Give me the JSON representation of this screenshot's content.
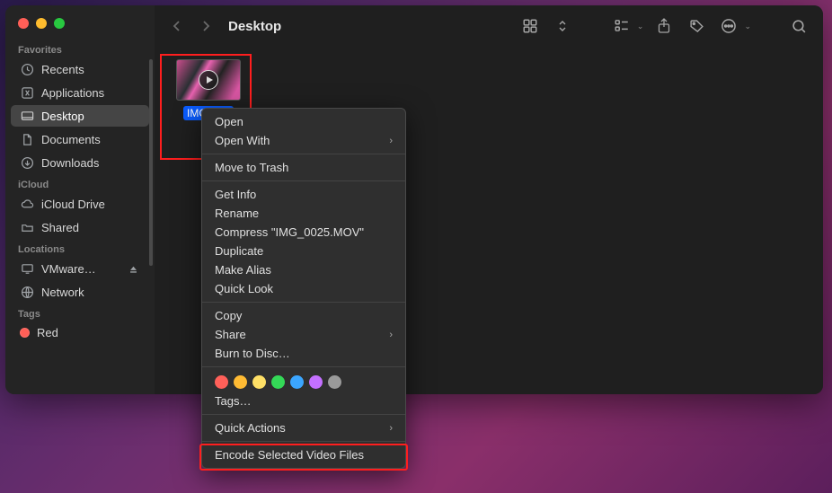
{
  "window": {
    "title": "Desktop"
  },
  "sidebar": {
    "sections": {
      "favorites": {
        "label": "Favorites",
        "items": [
          {
            "label": "Recents"
          },
          {
            "label": "Applications"
          },
          {
            "label": "Desktop"
          },
          {
            "label": "Documents"
          },
          {
            "label": "Downloads"
          }
        ]
      },
      "icloud": {
        "label": "iCloud",
        "items": [
          {
            "label": "iCloud Drive"
          },
          {
            "label": "Shared"
          }
        ]
      },
      "locations": {
        "label": "Locations",
        "items": [
          {
            "label": "VMware…"
          },
          {
            "label": "Network"
          }
        ]
      },
      "tags": {
        "label": "Tags",
        "items": [
          {
            "label": "Red",
            "color": "#ff5f57"
          }
        ]
      }
    }
  },
  "file": {
    "name": "IMG_0025.MOV",
    "displayed_name": "IMG_0…"
  },
  "context_menu": {
    "open": "Open",
    "open_with": "Open With",
    "move_to_trash": "Move to Trash",
    "get_info": "Get Info",
    "rename": "Rename",
    "compress": "Compress \"IMG_0025.MOV\"",
    "duplicate": "Duplicate",
    "make_alias": "Make Alias",
    "quick_look": "Quick Look",
    "copy": "Copy",
    "share": "Share",
    "burn": "Burn to Disc…",
    "tags_label": "Tags…",
    "quick_actions": "Quick Actions",
    "encode": "Encode Selected Video Files",
    "tag_colors": [
      "#ff6059",
      "#ffbb33",
      "#ffe066",
      "#34d957",
      "#3ba6ff",
      "#c470ff",
      "#9a9a9a"
    ]
  }
}
